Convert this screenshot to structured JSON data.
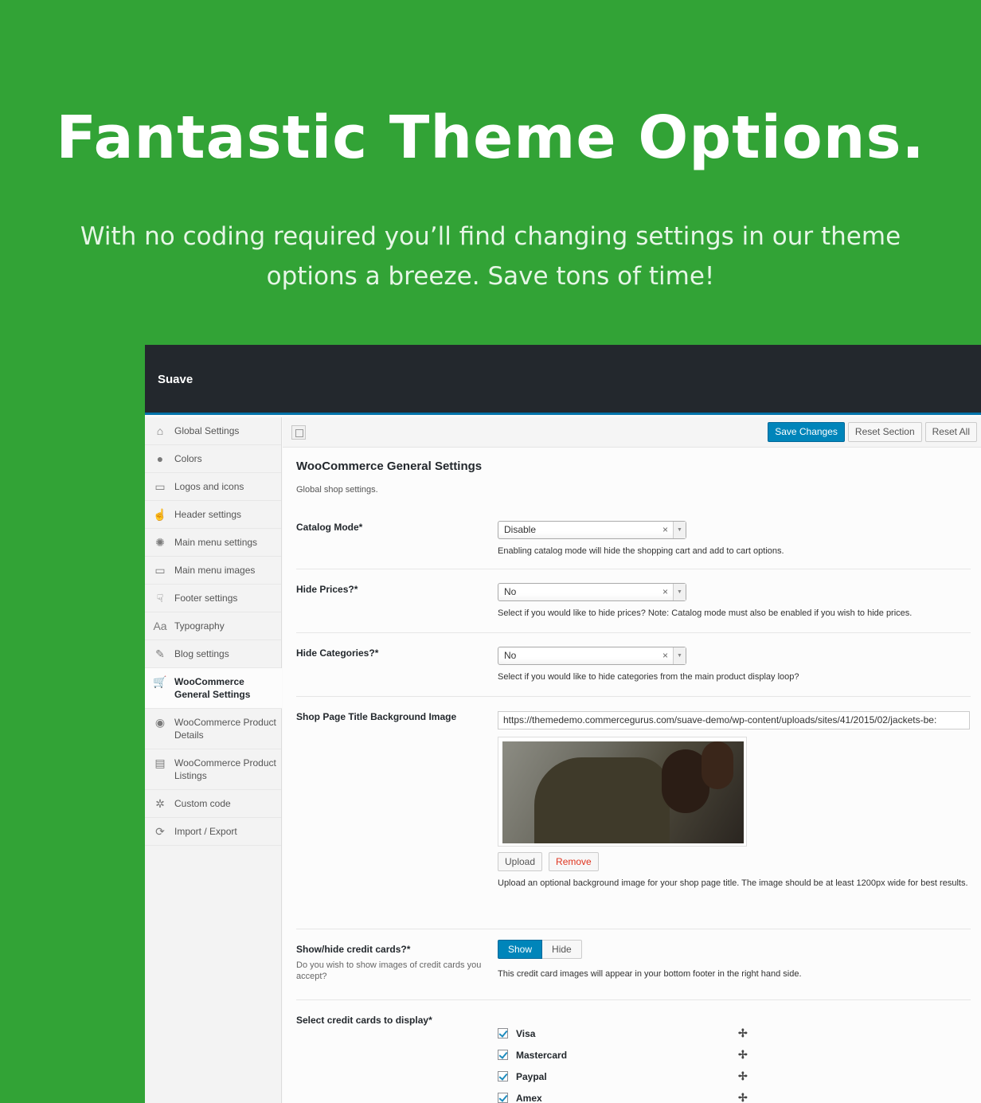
{
  "hero": {
    "title": "Fantastic Theme Options.",
    "subtitle_line1": "With no coding required you’ll find changing settings in our theme",
    "subtitle_line2": "options a breeze. Save tons of time!"
  },
  "panel": {
    "brand": "Suave",
    "sidebar": [
      {
        "label": "Global Settings",
        "icon": "home-icon",
        "glyph": "⌂"
      },
      {
        "label": "Colors",
        "icon": "droplet-icon",
        "glyph": "●"
      },
      {
        "label": "Logos and icons",
        "icon": "monitor-icon",
        "glyph": "▭"
      },
      {
        "label": "Header settings",
        "icon": "pointer-icon",
        "glyph": "☝"
      },
      {
        "label": "Main menu settings",
        "icon": "gear-circle-icon",
        "glyph": "✺"
      },
      {
        "label": "Main menu images",
        "icon": "monitor-icon",
        "glyph": "▭"
      },
      {
        "label": "Footer settings",
        "icon": "pointer-down-icon",
        "glyph": "☟"
      },
      {
        "label": "Typography",
        "icon": "typography-icon",
        "glyph": "Aa"
      },
      {
        "label": "Blog settings",
        "icon": "edit-icon",
        "glyph": "✎"
      },
      {
        "label": "WooCommerce General Settings",
        "icon": "cart-icon",
        "glyph": "🛒",
        "active": true
      },
      {
        "label": "WooCommerce Product Details",
        "icon": "cart-circle-icon",
        "glyph": "◉"
      },
      {
        "label": "WooCommerce Product Listings",
        "icon": "clipboard-icon",
        "glyph": "▤"
      },
      {
        "label": "Custom code",
        "icon": "cog-icon",
        "glyph": "✲"
      },
      {
        "label": "Import / Export",
        "icon": "refresh-icon",
        "glyph": "⟳"
      }
    ],
    "toolbar": {
      "save_label": "Save Changes",
      "reset_section_label": "Reset Section",
      "reset_all_label": "Reset All"
    },
    "section": {
      "title": "WooCommerce General Settings",
      "description": "Global shop settings."
    },
    "fields": {
      "catalog_mode": {
        "label": "Catalog Mode*",
        "value": "Disable",
        "help": "Enabling catalog mode will hide the shopping cart and add to cart options."
      },
      "hide_prices": {
        "label": "Hide Prices?*",
        "value": "No",
        "help": "Select if you would like to hide prices? Note: Catalog mode must also be enabled if you wish to hide prices."
      },
      "hide_categories": {
        "label": "Hide Categories?*",
        "value": "No",
        "help": "Select if you would like to hide categories from the main product display loop?"
      },
      "shop_bg": {
        "label": "Shop Page Title Background Image",
        "url": "https://themedemo.commercegurus.com/suave-demo/wp-content/uploads/sites/41/2015/02/jackets-be:",
        "upload_label": "Upload",
        "remove_label": "Remove",
        "help": "Upload an optional background image for your shop page title. The image should be at least 1200px wide for best results."
      },
      "credit_cards": {
        "label": "Show/hide credit cards?*",
        "sub": "Do you wish to show images of credit cards you accept?",
        "on_label": "Show",
        "off_label": "Hide",
        "help": "This credit card images will appear in your bottom footer in the right hand side."
      },
      "select_cards": {
        "label": "Select credit cards to display*",
        "items": [
          "Visa",
          "Mastercard",
          "Paypal",
          "Amex"
        ]
      }
    },
    "select_clear_glyph": "×",
    "select_arrow_glyph": "▼",
    "move_glyph": "✢"
  }
}
